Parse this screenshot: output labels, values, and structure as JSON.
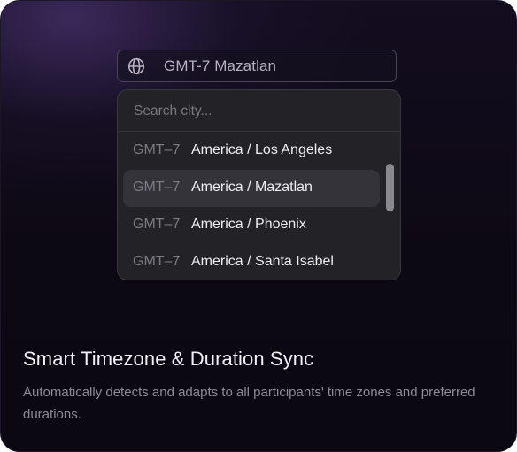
{
  "feature": {
    "title": "Smart Timezone & Duration Sync",
    "description": "Automatically detects and adapts to all participants' time zones and preferred durations."
  },
  "timezone_select": {
    "icon": "globe-icon",
    "selected_value": "GMT-7 Mazatlan"
  },
  "dropdown": {
    "search_placeholder": "Search city...",
    "search_value": "",
    "options": [
      {
        "offset": "GMT–7",
        "city": "America / Los Angeles",
        "selected": false
      },
      {
        "offset": "GMT–7",
        "city": "America / Mazatlan",
        "selected": true
      },
      {
        "offset": "GMT–7",
        "city": "America / Phoenix",
        "selected": false
      },
      {
        "offset": "GMT–7",
        "city": "America / Santa Isabel",
        "selected": false
      }
    ]
  },
  "colors": {
    "background": "#0d0914",
    "dropdown_bg": "#232226",
    "selected_row": "#34333a",
    "title_text": "#f2f0f6",
    "muted_text": "#8e8a99"
  }
}
